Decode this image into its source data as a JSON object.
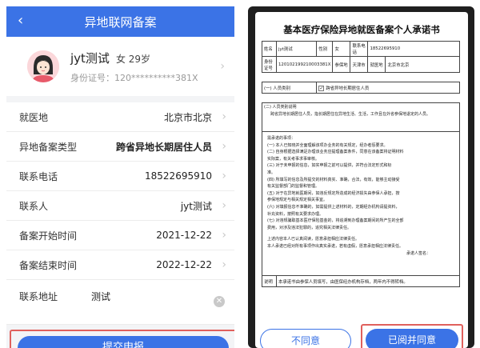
{
  "left": {
    "header": {
      "back_icon": "chevron-left-icon",
      "title": "异地联网备案"
    },
    "profile": {
      "name": "jyt测试",
      "gender_age": "女 29岁",
      "id_label": "身份证号：",
      "id_value": "120**********381X"
    },
    "rows": [
      {
        "label": "就医地",
        "value": "北京市北京"
      },
      {
        "label": "异地备案类型",
        "value": "跨省异地长期居住人员"
      },
      {
        "label": "联系电话",
        "value": "18522695910"
      },
      {
        "label": "联系人",
        "value": "jyt测试"
      },
      {
        "label": "备案开始时间",
        "value": "2021-12-22"
      },
      {
        "label": "备案结束时间",
        "value": "2022-12-22"
      }
    ],
    "address": {
      "label": "联系地址",
      "value": "测试"
    },
    "submit_label": "提交申报"
  },
  "right": {
    "doc_title": "基本医疗保险异地就医备案个人承诺书",
    "table": {
      "name_label": "姓名",
      "name_value": "jyt测试",
      "gender_label": "性别",
      "gender_value": "女",
      "phone_label": "联系电话",
      "phone_value": "18522695910",
      "id_label": "身份证号",
      "id_value": "120102199210003381X",
      "region_label": "参保地",
      "region_value": "天津市",
      "place_label": "就医地",
      "place_value": "北京市北京"
    },
    "section_a": {
      "label": "(一) 人员类别",
      "option_checked": "跨省异地长期居住人员"
    },
    "section_b": {
      "label": "(二) 人员类别说明",
      "text": "跨省异地长期居住人员，指长期居住在异地生活、生活，工作且在外省参保地退定的人员。"
    },
    "promise_title": "需承诺的事项：",
    "promise_lines": [
      "(一) 本人已知晓并全面理解该项办业务的有关规定，经办者惩要求。",
      "(二) 自身根据选择满足办理该业务应提理备案条件，同意在该备案将证明材料",
      "实际案，有关考事求事审核。",
      "(三) 对于未申报的信息，如实申报之前可以提供，并符合法定形式和标",
      "准。",
      "(四) 所填写的信息及所提交的材料真实、准确，合法，有效，能够主动接受",
      "有关监督部门的监督和管理。",
      "(五) 对于在异地就医期间，如违反规定所造成的经济损失由参保人承担，按",
      "参保地规定与相关规定相关事宜。",
      "(六) 对填报信息不准确的，如需提供上述材料的，定期经办机构请提资料，",
      "补充资料，按照有关要求办理。",
      "(七) 对违规骗取基本医疗保险基金的，将追溯到办理备案期间的所产生的全部",
      "费用，对涉及违法犯罪的，追究相关法律责任。"
    ],
    "closing_lines": [
      "上述内容本人已认真阅读，愿意承担相应法律责任。",
      "本人承诺已经对所有事项作出真实承诺，若有虚假，愿意承担相应法律责任。",
      "承诺人签名："
    ],
    "footer_label": "说明",
    "footer_text": "本承诺书由参保人员填写，由医保经办机构存档，两年内不得转档。",
    "disagree_label": "不同意",
    "agree_label": "已阅并同意"
  }
}
